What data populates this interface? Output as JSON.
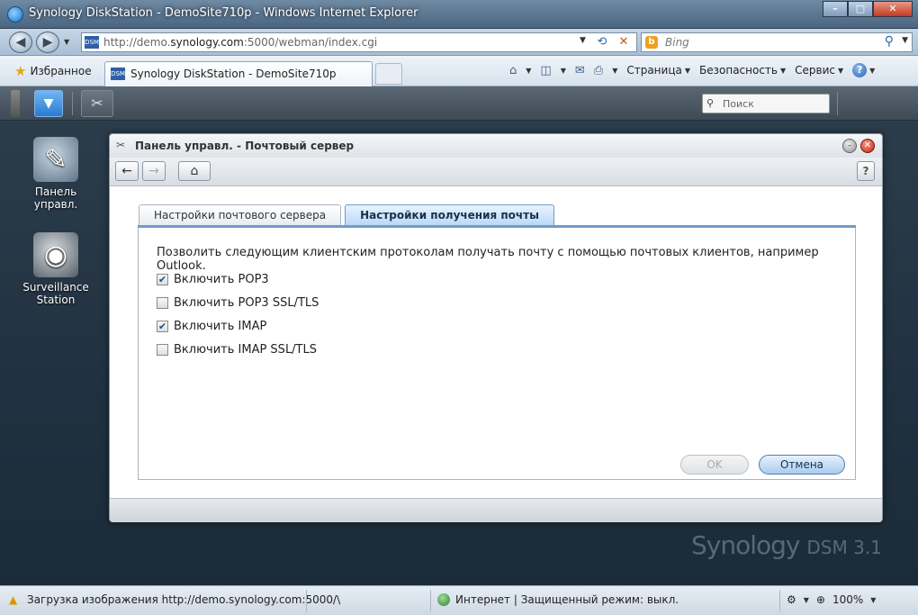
{
  "browser": {
    "window_title": "Synology DiskStation - DemoSite710p - Windows Internet Explorer",
    "url_prefix": "http://demo.",
    "url_host": "synology.com",
    "url_suffix": ":5000/webman/index.cgi",
    "search_placeholder": "Bing",
    "favorites_label": "Избранное",
    "tab_title": "Synology DiskStation - DemoSite710p",
    "favicon_text": "DSM",
    "menu": {
      "page": "Страница",
      "safety": "Безопасность",
      "service": "Сервис"
    }
  },
  "dsm": {
    "search_placeholder": "Поиск",
    "desktop_icons": [
      {
        "label": "Панель управл.",
        "icon": "control-panel-icon"
      },
      {
        "label": "Surveillance Station",
        "icon": "camera-icon"
      }
    ],
    "brand_name": "Synology",
    "brand_product": "DSM 3.1"
  },
  "app": {
    "title": "Панель управл. - Почтовый сервер",
    "tabs": [
      {
        "label": "Настройки почтового сервера",
        "active": false
      },
      {
        "label": "Настройки получения почты",
        "active": true
      }
    ],
    "description": "Позволить следующим клиентским протоколам получать почту с помощью почтовых клиентов, например Outlook.",
    "options": [
      {
        "label": "Включить POP3",
        "checked": true
      },
      {
        "label": "Включить POP3 SSL/TLS",
        "checked": false
      },
      {
        "label": "Включить IMAP",
        "checked": true
      },
      {
        "label": "Включить IMAP SSL/TLS",
        "checked": false
      }
    ],
    "ok_label": "OK",
    "cancel_label": "Отмена",
    "help_label": "?"
  },
  "status": {
    "loading_text": "Загрузка изображения http://demo.synology.com:5000/\\",
    "zone_text": "Интернет | Защищенный режим: выкл.",
    "zoom": "100%"
  },
  "colors": {
    "accent": "#6f9cc9",
    "active_tab": "#b9d8f6",
    "desktop": "#203040"
  }
}
